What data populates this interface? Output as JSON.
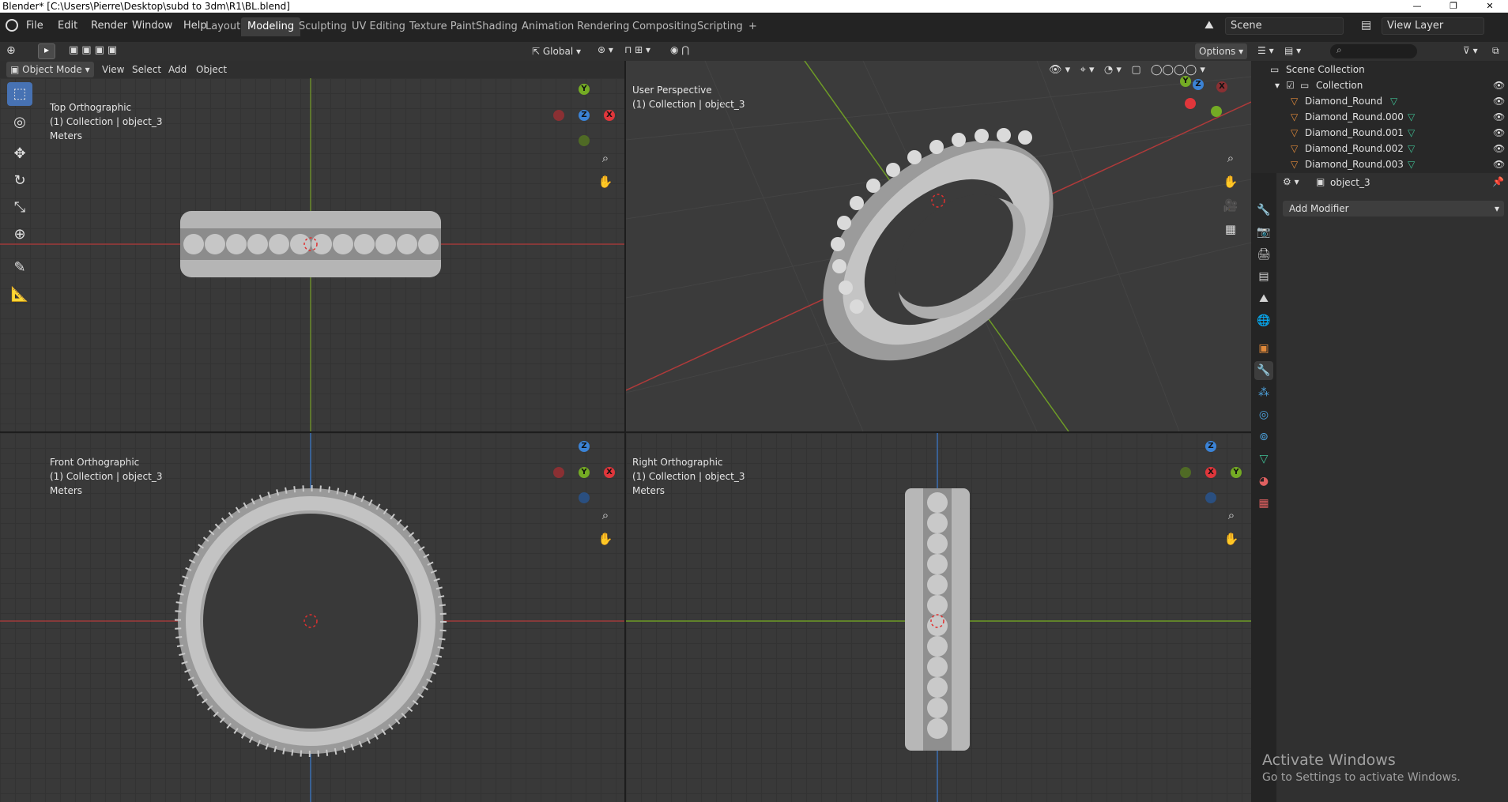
{
  "titlebar": {
    "title": "Blender* [C:\\Users\\Pierre\\Desktop\\subd to 3dm\\R1\\BL.blend]",
    "min": "—",
    "restore": "❐",
    "close": "✕"
  },
  "menus": [
    "File",
    "Edit",
    "Render",
    "Window",
    "Help"
  ],
  "workspaces": [
    "Layout",
    "Modeling",
    "Sculpting",
    "UV Editing",
    "Texture Paint",
    "Shading",
    "Animation",
    "Rendering",
    "Compositing",
    "Scripting",
    "+"
  ],
  "active_workspace": "Modeling",
  "scene": {
    "label": "Scene"
  },
  "view_layer": {
    "label": "View Layer"
  },
  "tool_header": {
    "orientation": "Global",
    "options": "Options"
  },
  "mode_header": {
    "mode": "Object Mode",
    "view": "View",
    "select": "Select",
    "add": "Add",
    "object": "Object"
  },
  "viewports": {
    "top": {
      "name": "Top Orthographic",
      "collection": "(1) Collection | object_3",
      "units": "Meters"
    },
    "persp": {
      "name": "User Perspective",
      "collection": "(1) Collection | object_3"
    },
    "front": {
      "name": "Front Orthographic",
      "collection": "(1) Collection | object_3",
      "units": "Meters"
    },
    "right": {
      "name": "Right Orthographic",
      "collection": "(1) Collection | object_3",
      "units": "Meters"
    }
  },
  "gizmo": {
    "x": "X",
    "y": "Y",
    "z": "Z"
  },
  "outliner": {
    "root": "Scene Collection",
    "collection": "Collection",
    "items": [
      "Diamond_Round",
      "Diamond_Round.000",
      "Diamond_Round.001",
      "Diamond_Round.002",
      "Diamond_Round.003"
    ]
  },
  "properties": {
    "object": "object_3",
    "add_modifier": "Add Modifier"
  },
  "watermark": {
    "title": "Activate Windows",
    "subtitle": "Go to Settings to activate Windows."
  },
  "colors": {
    "accent": "#4772b3",
    "x_axis": "#e0363b",
    "y_axis": "#74ab24",
    "z_axis": "#3b83d6",
    "header": "#303030",
    "viewport": "#393939"
  }
}
